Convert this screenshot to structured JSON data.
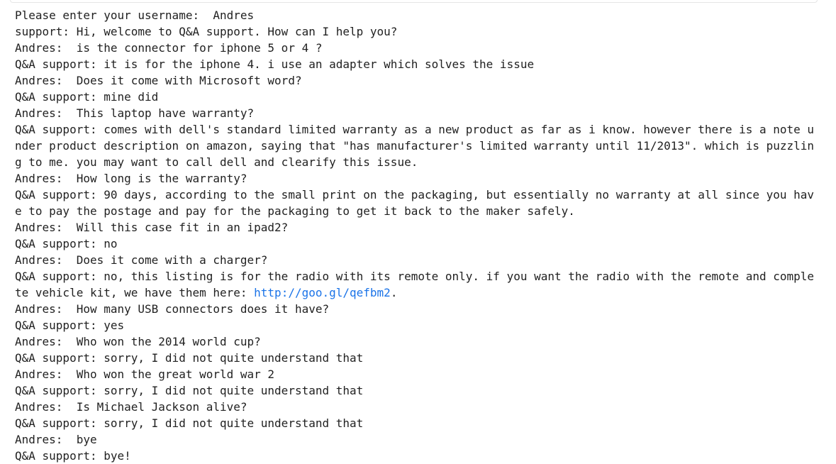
{
  "transcript": {
    "lines": [
      {
        "speaker": "prompt",
        "text": "Please enter your username:  Andres"
      },
      {
        "speaker": "bot",
        "text": "support: Hi, welcome to Q&A support. How can I help you?"
      },
      {
        "speaker": "user",
        "text": "Andres:  is the connector for iphone 5 or 4 ?"
      },
      {
        "speaker": "bot",
        "text": "Q&A support: it is for the iphone 4. i use an adapter which solves the issue"
      },
      {
        "speaker": "user",
        "text": "Andres:  Does it come with Microsoft word?"
      },
      {
        "speaker": "bot",
        "text": "Q&A support: mine did"
      },
      {
        "speaker": "user",
        "text": "Andres:  This laptop have warranty?"
      },
      {
        "speaker": "bot",
        "text": "Q&A support: comes with dell's standard limited warranty as a new product as far as i know. however there is a note under product description on amazon, saying that \"has manufacturer's limited warranty until 11/2013\". which is puzzling to me. you may want to call dell and clearify this issue."
      },
      {
        "speaker": "user",
        "text": "Andres:  How long is the warranty?"
      },
      {
        "speaker": "bot",
        "text": "Q&A support: 90 days, according to the small print on the packaging, but essentially no warranty at all since you have to pay the postage and pay for the packaging to get it back to the maker safely."
      },
      {
        "speaker": "user",
        "text": "Andres:  Will this case fit in an ipad2?"
      },
      {
        "speaker": "bot",
        "text": "Q&A support: no"
      },
      {
        "speaker": "user",
        "text": "Andres:  Does it come with a charger?"
      },
      {
        "speaker": "bot",
        "text": "Q&A support: no, this listing is for the radio with its remote only. if you want the radio with the remote and complete vehicle kit, we have them here: ",
        "link": "http://goo.gl/qefbm2",
        "suffix": "."
      },
      {
        "speaker": "user",
        "text": "Andres:  How many USB connectors does it have?"
      },
      {
        "speaker": "bot",
        "text": "Q&A support: yes"
      },
      {
        "speaker": "user",
        "text": "Andres:  Who won the 2014 world cup?"
      },
      {
        "speaker": "bot",
        "text": "Q&A support: sorry, I did not quite understand that"
      },
      {
        "speaker": "user",
        "text": "Andres:  Who won the great world war 2"
      },
      {
        "speaker": "bot",
        "text": "Q&A support: sorry, I did not quite understand that"
      },
      {
        "speaker": "user",
        "text": "Andres:  Is Michael Jackson alive?"
      },
      {
        "speaker": "bot",
        "text": "Q&A support: sorry, I did not quite understand that"
      },
      {
        "speaker": "user",
        "text": "Andres:  bye"
      },
      {
        "speaker": "bot",
        "text": "Q&A support: bye!"
      }
    ]
  },
  "colors": {
    "text": "#212121",
    "link": "#1a73e8",
    "background": "#ffffff"
  }
}
